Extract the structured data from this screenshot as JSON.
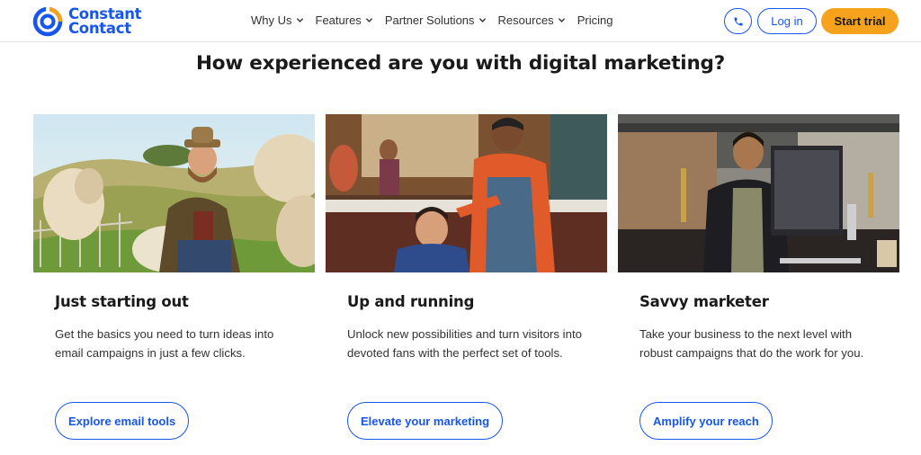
{
  "brand": {
    "line1": "Constant",
    "line2": "Contact",
    "color": "#1756ec",
    "accent": "#f7a21c"
  },
  "nav": {
    "items": [
      {
        "label": "Why Us",
        "has_dropdown": true
      },
      {
        "label": "Features",
        "has_dropdown": true
      },
      {
        "label": "Partner Solutions",
        "has_dropdown": true
      },
      {
        "label": "Resources",
        "has_dropdown": true
      },
      {
        "label": "Pricing",
        "has_dropdown": false
      }
    ],
    "phone_icon": "phone-icon",
    "login_label": "Log in",
    "trial_label": "Start trial"
  },
  "main": {
    "heading": "How experienced are you with digital marketing?",
    "cards": [
      {
        "image": "farmer-with-sheep",
        "title": "Just starting out",
        "description": "Get the basics you need to turn ideas into email campaigns in just a few clicks.",
        "button": "Explore email tools"
      },
      {
        "image": "barber-cutting-boys-hair",
        "title": "Up and running",
        "description": "Unlock new possibilities and turn visitors into devoted fans with the perfect set of tools.",
        "button": "Elevate your marketing"
      },
      {
        "image": "woman-at-computer",
        "title": "Savvy marketer",
        "description": "Take your business to the next level with robust campaigns that do the work for you.",
        "button": "Amplify your reach"
      }
    ]
  }
}
